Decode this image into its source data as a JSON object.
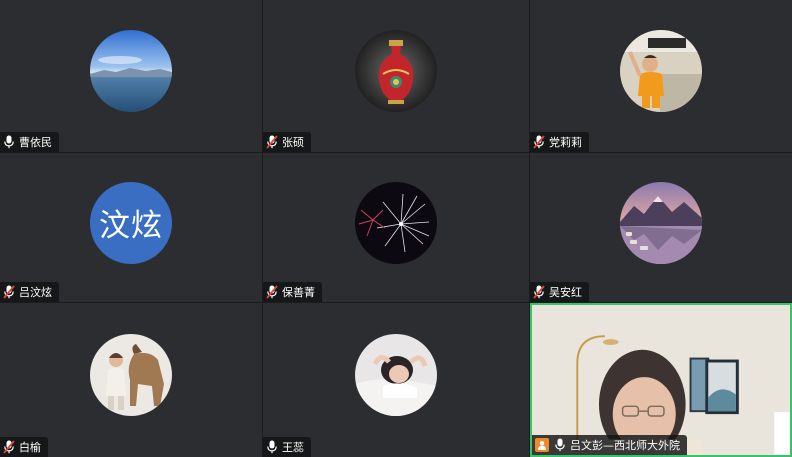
{
  "participants": [
    {
      "name": "曹依民",
      "mic": "on",
      "avatar": "lake-photo"
    },
    {
      "name": "张硕",
      "mic": "off",
      "avatar": "vase-photo"
    },
    {
      "name": "党莉莉",
      "mic": "off",
      "avatar": "child-photo"
    },
    {
      "name": "吕汶炫",
      "mic": "off",
      "avatar_text": "汶炫",
      "avatar_color": "#3a6ec2"
    },
    {
      "name": "保善菁",
      "mic": "off",
      "avatar": "fireworks-photo"
    },
    {
      "name": "吴安红",
      "mic": "off",
      "avatar": "mountain-lake-photo"
    },
    {
      "name": "白榆",
      "mic": "off",
      "avatar": "woman-with-horse-photo"
    },
    {
      "name": "王蕊",
      "mic": "on",
      "avatar": "resting-girl-photo"
    },
    {
      "name": "吕文彭—西北师大外院",
      "mic": "on",
      "video": "on",
      "speaking": true
    }
  ],
  "colors": {
    "tile_bg": "#2b2d30",
    "active_border": "#35c46a",
    "mic_off": "#e0453a",
    "host_badge": "#f0892c"
  }
}
